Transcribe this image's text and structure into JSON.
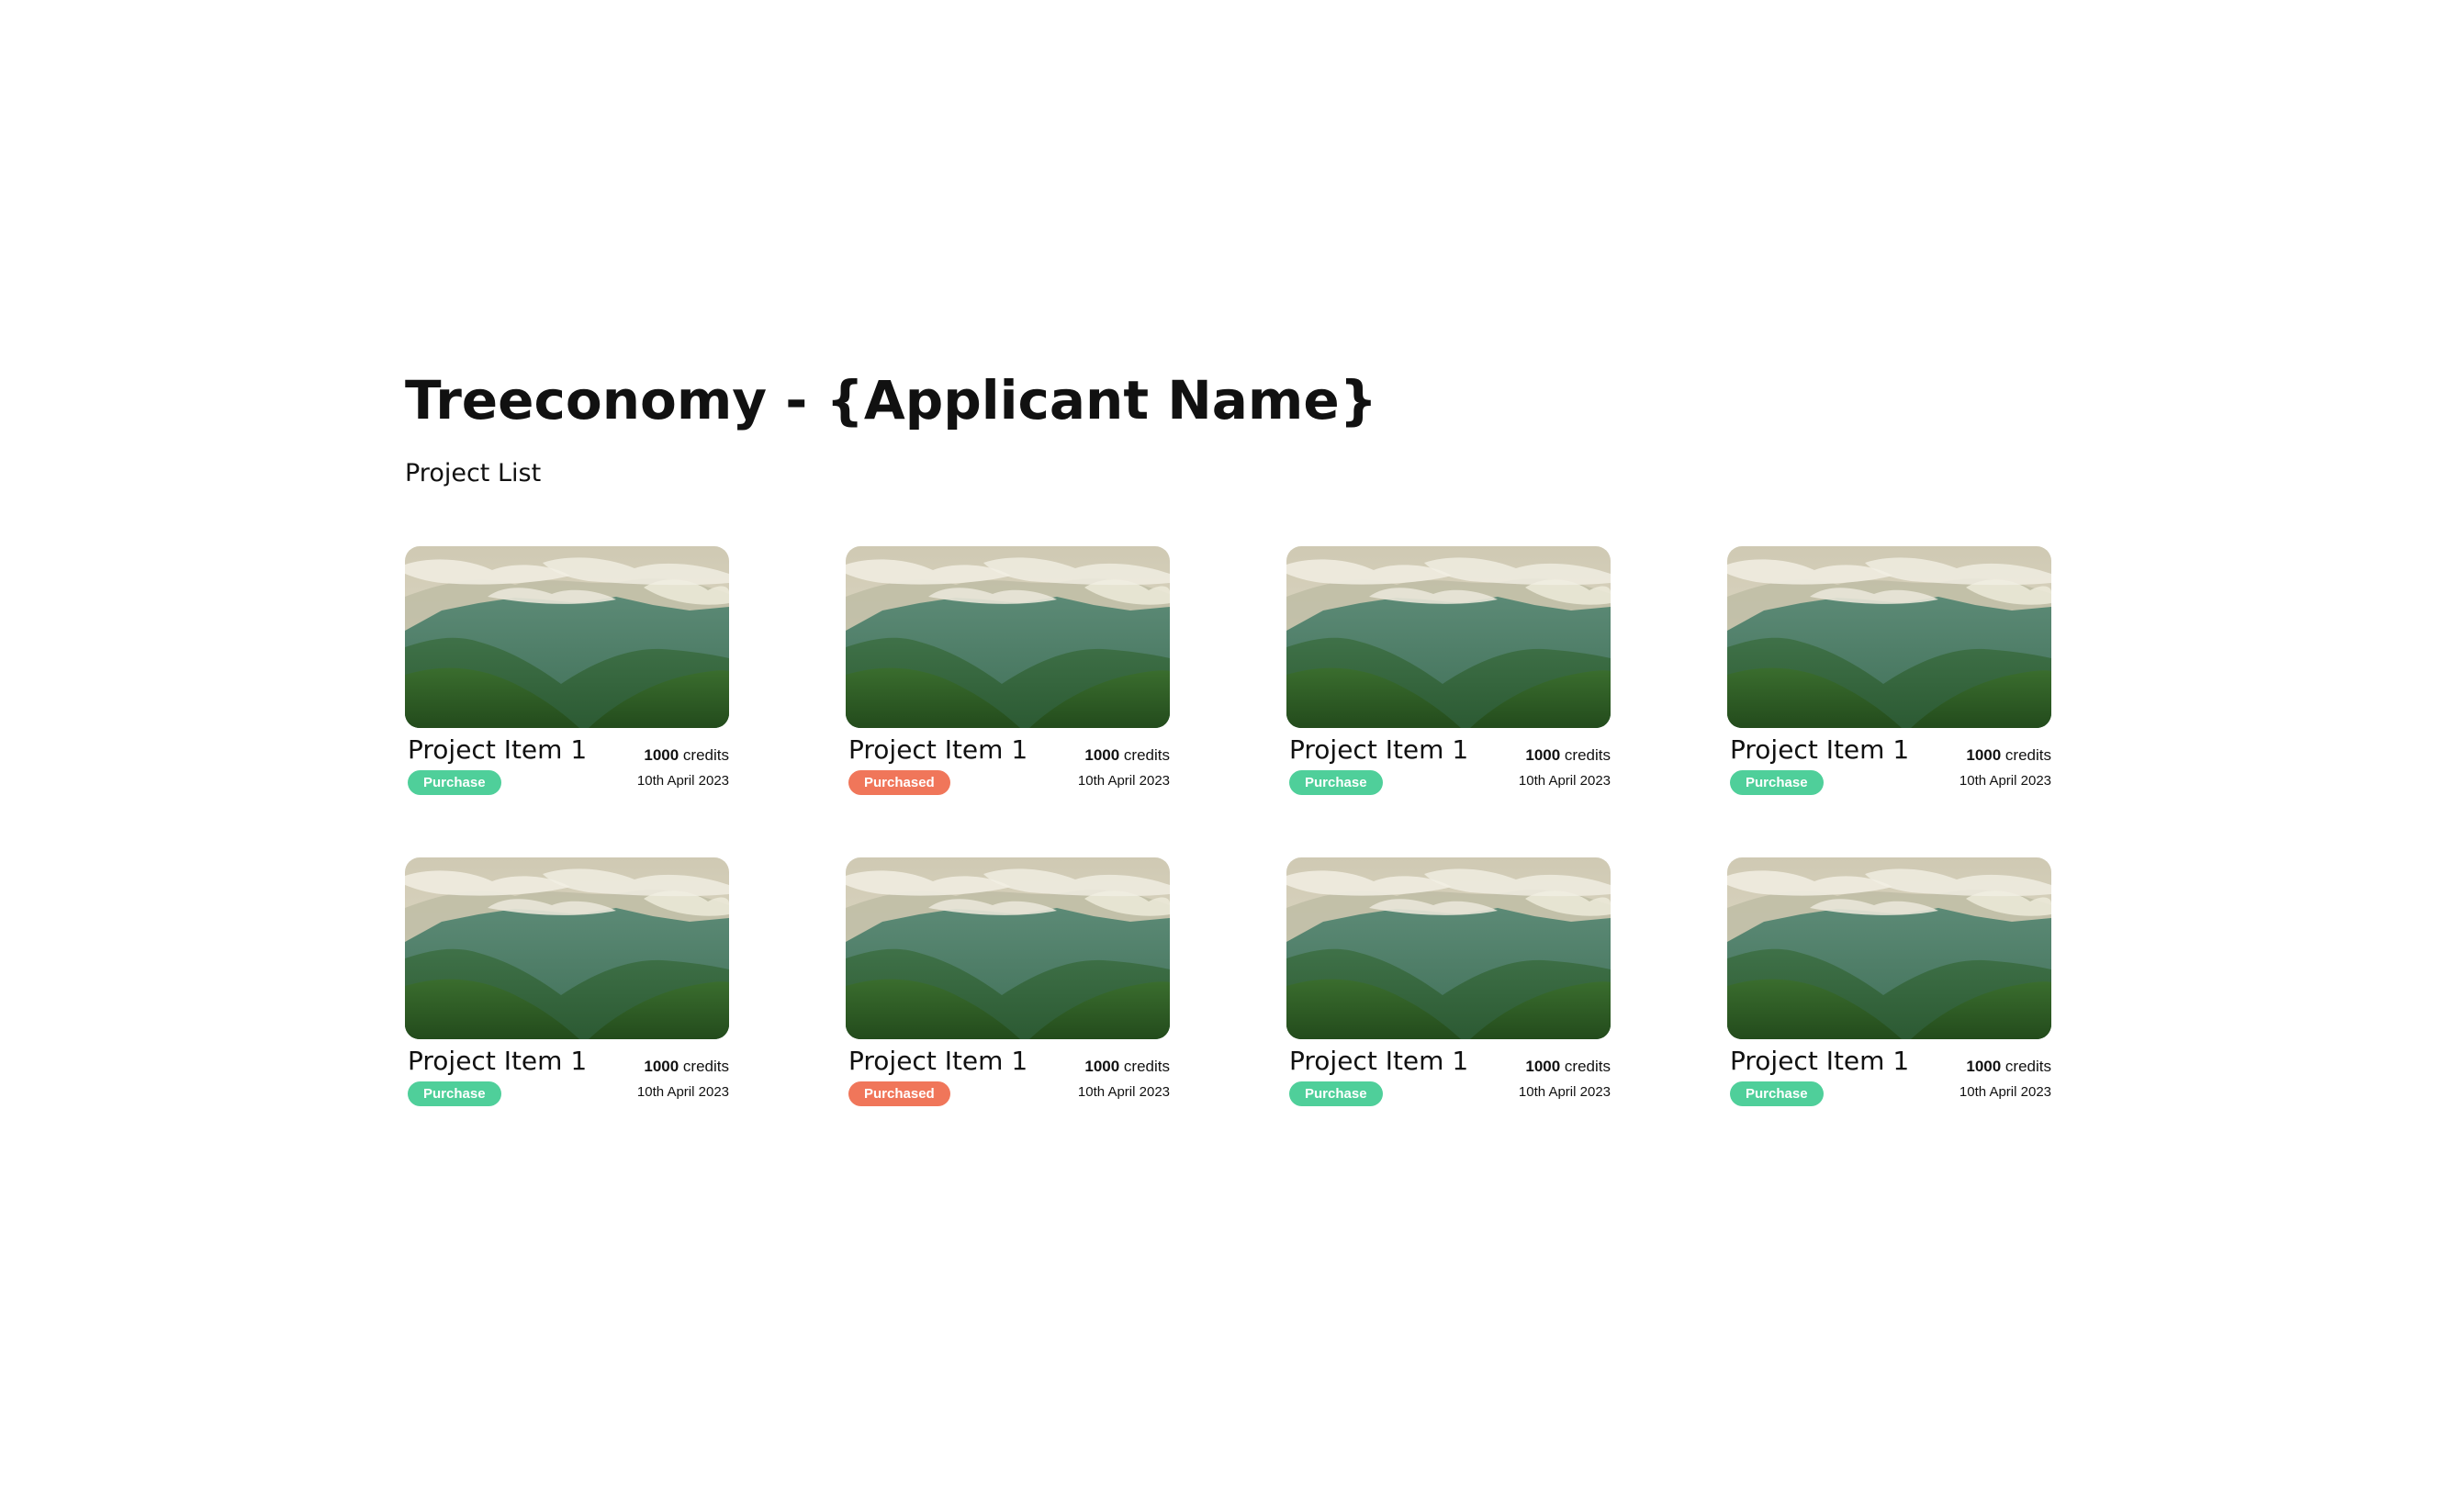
{
  "header": {
    "title": "Treeconomy - {Applicant Name}",
    "subtitle": "Project List"
  },
  "colors": {
    "purchase": "#4fcf9a",
    "purchased": "#f0765a",
    "text": "#111111"
  },
  "image_icon": "mountain-forest-landscape",
  "projects": [
    {
      "title": "Project Item 1",
      "credits_value": "1000",
      "credits_unit": "credits",
      "date": "10th April 2023",
      "status": "Purchase",
      "status_type": "available"
    },
    {
      "title": "Project Item 1",
      "credits_value": "1000",
      "credits_unit": "credits",
      "date": "10th April 2023",
      "status": "Purchased",
      "status_type": "purchased"
    },
    {
      "title": "Project Item 1",
      "credits_value": "1000",
      "credits_unit": "credits",
      "date": "10th April 2023",
      "status": "Purchase",
      "status_type": "available"
    },
    {
      "title": "Project Item 1",
      "credits_value": "1000",
      "credits_unit": "credits",
      "date": "10th April 2023",
      "status": "Purchase",
      "status_type": "available"
    },
    {
      "title": "Project Item 1",
      "credits_value": "1000",
      "credits_unit": "credits",
      "date": "10th April 2023",
      "status": "Purchase",
      "status_type": "available"
    },
    {
      "title": "Project Item 1",
      "credits_value": "1000",
      "credits_unit": "credits",
      "date": "10th April 2023",
      "status": "Purchased",
      "status_type": "purchased"
    },
    {
      "title": "Project Item 1",
      "credits_value": "1000",
      "credits_unit": "credits",
      "date": "10th April 2023",
      "status": "Purchase",
      "status_type": "available"
    },
    {
      "title": "Project Item 1",
      "credits_value": "1000",
      "credits_unit": "credits",
      "date": "10th April 2023",
      "status": "Purchase",
      "status_type": "available"
    }
  ]
}
